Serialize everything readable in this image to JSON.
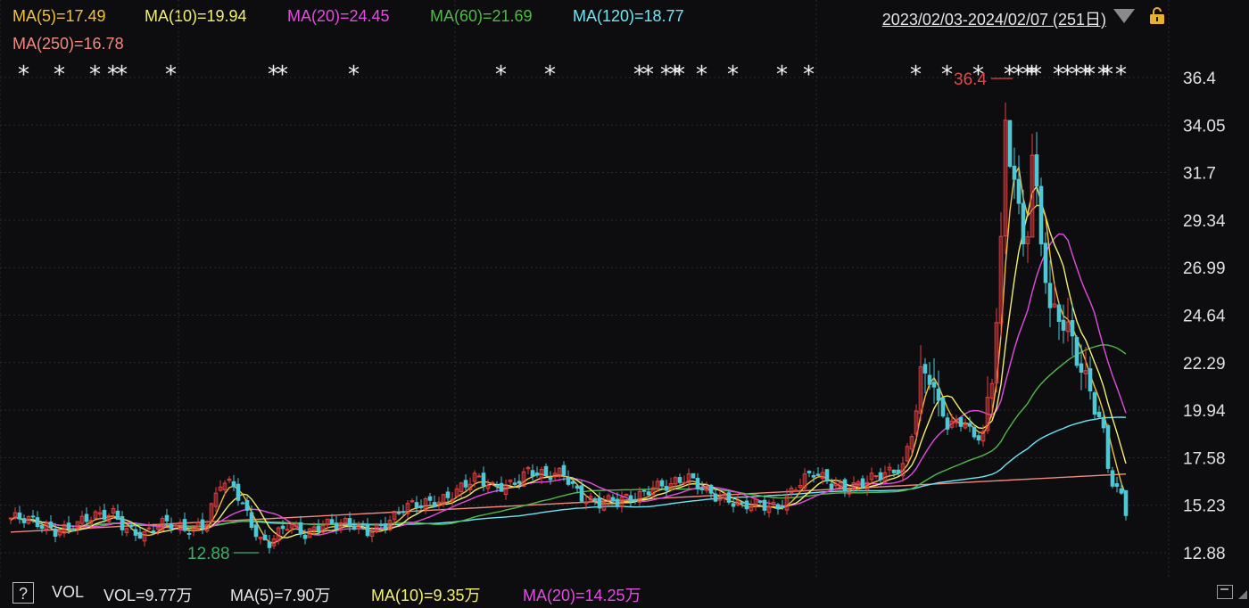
{
  "legend": {
    "ma5": "MA(5)=17.49",
    "ma10": "MA(10)=19.94",
    "ma20": "MA(20)=24.45",
    "ma60": "MA(60)=21.69",
    "ma120": "MA(120)=18.77",
    "ma250": "MA(250)=16.78"
  },
  "date_range": "2023/02/03-2024/02/07 (251日)",
  "colors": {
    "ma5": "#f0c040",
    "ma10": "#f2ef72",
    "ma20": "#e24ce0",
    "ma60": "#52b84a",
    "ma120": "#6fe6f2",
    "ma250": "#f08a80",
    "up": "#e84040",
    "down": "#4ec8d4",
    "grid": "#2b2b30",
    "axis_text": "#e0e0e0"
  },
  "bottom": {
    "help": "?",
    "vol_title": "VOL",
    "vol": "VOL=9.77万",
    "vol_ma5": "MA(5)=7.90万",
    "vol_ma10": "MA(10)=9.35万",
    "vol_ma20": "MA(20)=14.25万"
  },
  "chart_data": {
    "type": "candlestick",
    "y_ticks": [
      "36.4",
      "34.05",
      "31.7",
      "29.34",
      "26.99",
      "24.64",
      "22.29",
      "19.94",
      "17.58",
      "15.23",
      "12.88"
    ],
    "ylim": [
      12.88,
      36.4
    ],
    "n_days": 251,
    "annotations": [
      {
        "text": "36.4",
        "kind": "high",
        "index": 225
      },
      {
        "text": "12.88",
        "kind": "low",
        "index": 56
      }
    ],
    "star_marker": "*",
    "star_indices": [
      3,
      11,
      19,
      23,
      25,
      36,
      59,
      61,
      77,
      110,
      121,
      141,
      143,
      147,
      149,
      150,
      155,
      162,
      173,
      179,
      203,
      210,
      217,
      224,
      226,
      228,
      229,
      230,
      235,
      237,
      239,
      241,
      242,
      245,
      246,
      249
    ],
    "ma_last": {
      "MA5": 17.49,
      "MA10": 19.94,
      "MA20": 24.45,
      "MA60": 21.69,
      "MA120": 18.77,
      "MA250": 16.78
    },
    "close_anchors": [
      [
        0,
        14.6
      ],
      [
        5,
        14.3
      ],
      [
        10,
        14.1
      ],
      [
        15,
        14.3
      ],
      [
        20,
        14.6
      ],
      [
        23,
        14.9
      ],
      [
        26,
        14.2
      ],
      [
        30,
        13.7
      ],
      [
        35,
        14.3
      ],
      [
        40,
        14.2
      ],
      [
        44,
        14.4
      ],
      [
        47,
        16.2
      ],
      [
        50,
        16.1
      ],
      [
        53,
        14.9
      ],
      [
        56,
        13.6
      ],
      [
        58,
        13.4
      ],
      [
        62,
        14.1
      ],
      [
        66,
        13.8
      ],
      [
        70,
        14.5
      ],
      [
        75,
        14.2
      ],
      [
        80,
        13.9
      ],
      [
        84,
        14.5
      ],
      [
        88,
        15.1
      ],
      [
        92,
        15.1
      ],
      [
        96,
        15.5
      ],
      [
        100,
        16.1
      ],
      [
        104,
        16.5
      ],
      [
        108,
        16.0
      ],
      [
        112,
        16.4
      ],
      [
        116,
        17.0
      ],
      [
        120,
        16.5
      ],
      [
        124,
        16.8
      ],
      [
        128,
        15.8
      ],
      [
        132,
        15.3
      ],
      [
        136,
        15.3
      ],
      [
        140,
        15.7
      ],
      [
        144,
        16.3
      ],
      [
        148,
        16.1
      ],
      [
        152,
        16.5
      ],
      [
        156,
        16.1
      ],
      [
        160,
        15.6
      ],
      [
        164,
        15.0
      ],
      [
        168,
        15.3
      ],
      [
        172,
        15.3
      ],
      [
        176,
        16.1
      ],
      [
        180,
        16.7
      ],
      [
        184,
        16.4
      ],
      [
        188,
        16.2
      ],
      [
        192,
        16.3
      ],
      [
        196,
        16.7
      ],
      [
        200,
        17.3
      ],
      [
        202,
        19.0
      ],
      [
        204,
        21.7
      ],
      [
        206,
        21.5
      ],
      [
        208,
        20.0
      ],
      [
        210,
        19.1
      ],
      [
        212,
        19.3
      ],
      [
        214,
        19.5
      ],
      [
        216,
        18.7
      ],
      [
        218,
        19.0
      ],
      [
        220,
        21.2
      ],
      [
        221,
        24.5
      ],
      [
        222,
        28.0
      ],
      [
        223,
        33.5
      ],
      [
        224,
        32.0
      ],
      [
        225,
        31.5
      ],
      [
        226,
        29.7
      ],
      [
        227,
        28.0
      ],
      [
        228,
        29.2
      ],
      [
        229,
        33.0
      ],
      [
        230,
        30.9
      ],
      [
        231,
        28.5
      ],
      [
        232,
        27.0
      ],
      [
        233,
        25.0
      ],
      [
        235,
        24.4
      ],
      [
        237,
        23.6
      ],
      [
        239,
        22.3
      ],
      [
        241,
        21.4
      ],
      [
        243,
        20.5
      ],
      [
        245,
        19.0
      ],
      [
        246,
        17.3
      ],
      [
        247,
        16.5
      ],
      [
        249,
        15.6
      ],
      [
        250,
        14.8
      ]
    ]
  }
}
